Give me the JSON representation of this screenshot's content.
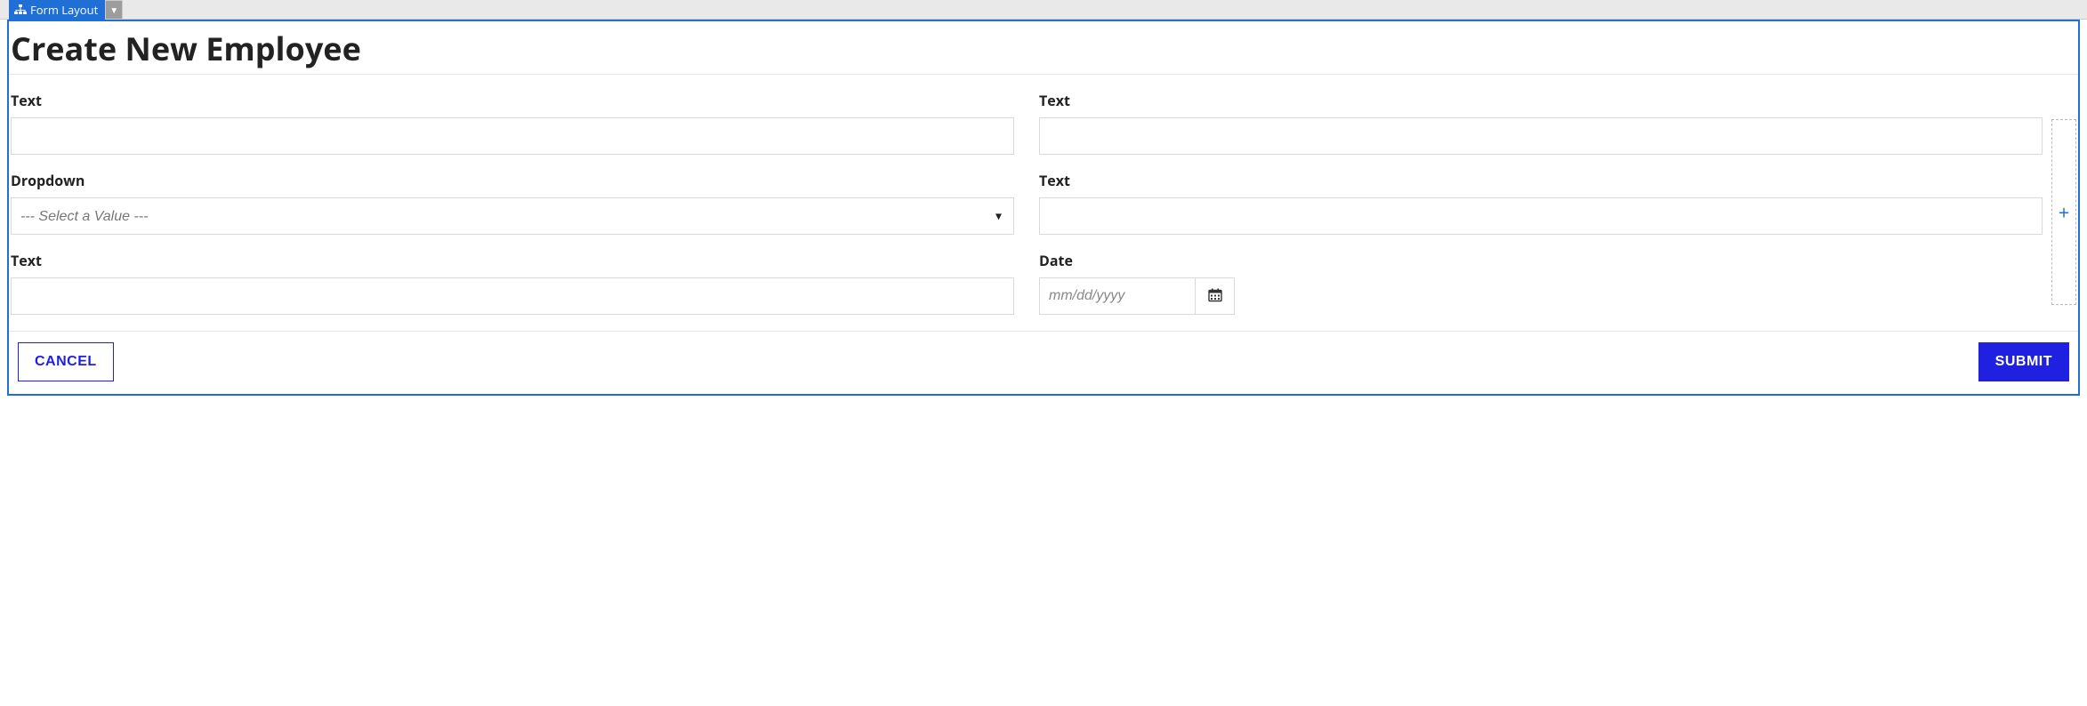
{
  "topbar": {
    "tag_label": "Form Layout"
  },
  "form": {
    "title": "Create New Employee",
    "dropdown_placeholder": "--- Select a Value ---",
    "date_placeholder": "mm/dd/yyyy",
    "fields": {
      "f0": {
        "label": "Text"
      },
      "f1": {
        "label": "Text"
      },
      "f2": {
        "label": "Dropdown"
      },
      "f3": {
        "label": "Text"
      },
      "f4": {
        "label": "Text"
      },
      "f5": {
        "label": "Date"
      }
    },
    "actions": {
      "cancel": "CANCEL",
      "submit": "SUBMIT"
    }
  },
  "icons": {
    "sitemap": "sitemap-icon",
    "caret_down": "caret-down-icon",
    "calendar": "calendar-icon",
    "plus": "plus-icon"
  }
}
